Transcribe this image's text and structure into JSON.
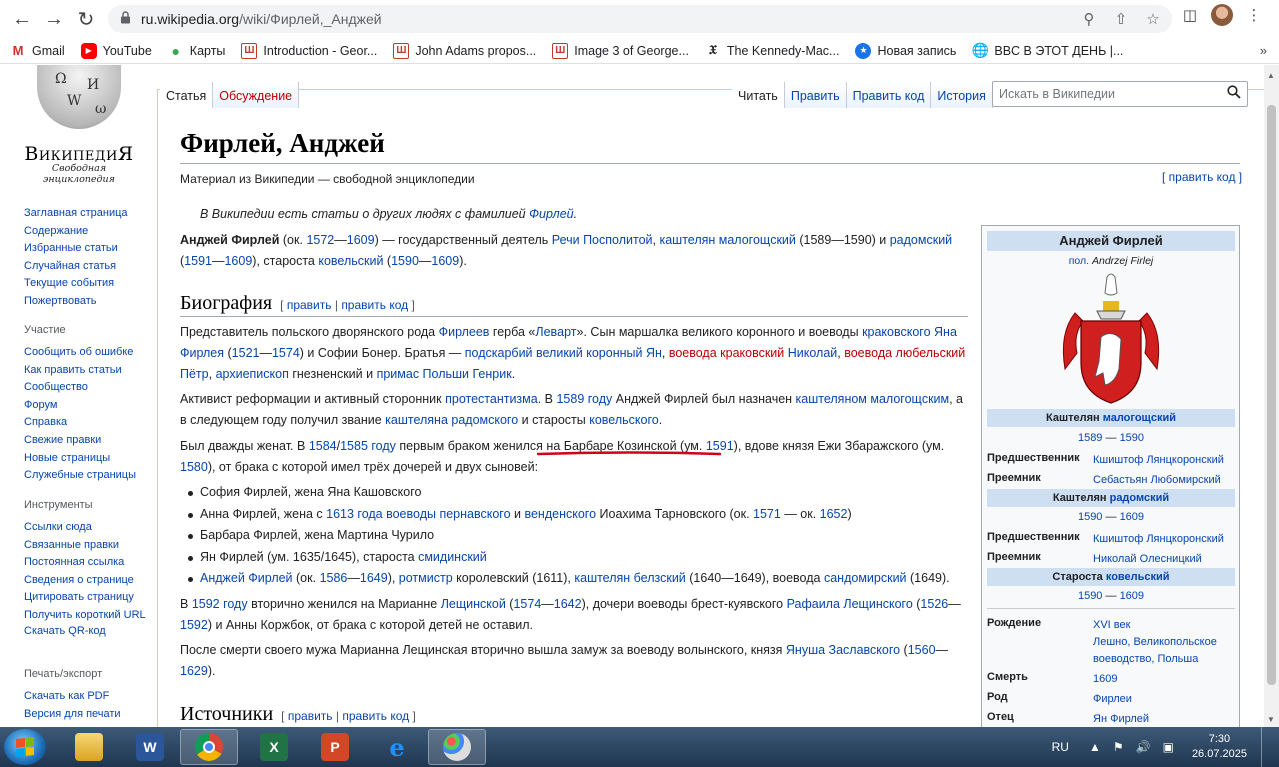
{
  "browser": {
    "url_host": "ru.wikipedia.org",
    "url_path": "/wiki/Фирлей,_Анджей",
    "bookmarks": [
      {
        "label": "Gmail",
        "icon": "gmail-icon"
      },
      {
        "label": "YouTube",
        "icon": "youtube-icon"
      },
      {
        "label": "Карты",
        "icon": "maps-icon"
      },
      {
        "label": "Introduction - Geor...",
        "icon": "bookmark-site-icon"
      },
      {
        "label": "John Adams propos...",
        "icon": "bookmark-site-icon"
      },
      {
        "label": "Image 3 of George...",
        "icon": "bookmark-site-icon"
      },
      {
        "label": "The Kennedy-Mac...",
        "icon": "nyt-icon"
      },
      {
        "label": "Новая запись",
        "icon": "bookmark-site-icon"
      },
      {
        "label": "BBC В ЭТОТ ДЕНЬ |...",
        "icon": "globe-icon"
      }
    ]
  },
  "wiki": {
    "logo_word": "ВикипедиЯ",
    "logo_tagline": "Свободная энциклопедия",
    "nav_main": [
      "Заглавная страница",
      "Содержание",
      "Избранные статьи",
      "Случайная статья",
      "Текущие события",
      "Пожертвовать"
    ],
    "participation_title": "Участие",
    "nav_participation": [
      "Сообщить об ошибке",
      "Как править статьи",
      "Сообщество",
      "Форум",
      "Справка",
      "Свежие правки",
      "Новые страницы",
      "Служебные страницы"
    ],
    "tools_title": "Инструменты",
    "nav_tools": [
      "Ссылки сюда",
      "Связанные правки",
      "Постоянная ссылка",
      "Сведения о странице",
      "Цитировать страницу",
      "Получить короткий URL",
      "Скачать QR-код"
    ],
    "print_title": "Печать/экспорт",
    "nav_print": [
      "Скачать как PDF",
      "Версия для печати"
    ],
    "tab_article": "Статья",
    "tab_talk": "Обсуждение",
    "tab_read": "Читать",
    "tab_edit": "Править",
    "tab_editsource": "Править код",
    "tab_history": "История",
    "search_placeholder": "Искать в Википедии",
    "title": "Фирлей, Анджей",
    "tagline": "Материал из Википедии — свободной энциклопедии",
    "edit_lead": "[ править код ]",
    "hatnote_text": "В Википедии есть статьи о других людях с фамилией ",
    "hatnote_link": "Фирлей",
    "lead": {
      "b1": "Анджей Фирлей",
      "t1": " (ок. ",
      "l1": "1572",
      "t2": "—",
      "l2": "1609",
      "t3": ") — государственный деятель ",
      "l3": "Речи Посполитой",
      "t4": ", ",
      "l4": "каштелян малогощский",
      "t5": " (1589—1590) и ",
      "l5": "радомский",
      "t6": " (",
      "l6": "1591",
      "t7": "—",
      "l7": "1609",
      "t8": "), староста ",
      "l8": "ковельский",
      "t9": " (",
      "l9": "1590",
      "t10": "—",
      "l10": "1609",
      "t11": ")."
    },
    "bio_heading": "Биография",
    "sec_edit": "править",
    "sec_editsource": "править код",
    "sec_open": "[",
    "sec_pipe": "|",
    "sec_close": "]",
    "p1": {
      "t1": "Представитель польского дворянского рода ",
      "l1": "Фирлеев",
      "t2": " герба «",
      "l2": "Левaрт",
      "t3": "». Сын маршалка великого коронного и воеводы ",
      "l3": "краковского Яна Фирлея",
      "t4": " (",
      "l4": "1521",
      "t5": "—",
      "l5": "1574",
      "t6": ") и Софии Бонер. Братья — ",
      "l6": "подскарбий великий коронный Ян",
      "t7": ", ",
      "r1": "воевода краковский",
      "t8": " ",
      "l7": "Николай",
      "t9": ", ",
      "r2": "воевода любельский",
      "t10": " ",
      "l8": "Пётр",
      "t11": ", ",
      "l9": "архиепископ",
      "t12": " гнезненский и ",
      "l10": "примас Польши Генрик",
      "t13": "."
    },
    "p2": {
      "t1": "Активист реформации и активный сторонник ",
      "l1": "протестантизма",
      "t2": ". В ",
      "l2": "1589 году",
      "t3": " Анджей Фирлей был назначен ",
      "l3": "каштеляном малогощским",
      "t4": ", а в следующем году получил звание ",
      "l4": "каштеляна радомского",
      "t5": " и старосты ",
      "l5": "ковельского",
      "t6": "."
    },
    "p3": {
      "t1": "Был дважды женат. В ",
      "l1": "1584",
      "t2": "/",
      "l2": "1585 году",
      "t3": " первым браком женился на Барбаре Козинской (ум. ",
      "l3": "1591",
      "t4": "), вдове князя Ежи Збаражского (ум. ",
      "l4": "1580",
      "t5": "), от брака с которой имел трёх дочерей и двух сыновей:"
    },
    "children": {
      "c1": "София Фирлей, жена Яна Кашовского",
      "c2a": "Анна Фирлей, жена с ",
      "c2b": "1613 года",
      "c2c": " ",
      "c2d": "воеводы пернавского",
      "c2e": " и ",
      "c2f": "венденского",
      "c2g": " Иоахима Тарновского (ок. ",
      "c2h": "1571",
      "c2i": " — ок. ",
      "c2j": "1652",
      "c2k": ")",
      "c3": "Барбара Фирлей, жена Мартина Чурило",
      "c4a": "Ян Фирлей (ум. 1635/1645), староста ",
      "c4b": "смидинский",
      "c5a": "Анджей Фирлей",
      "c5b": " (ок. ",
      "c5c": "1586",
      "c5d": "—",
      "c5e": "1649",
      "c5f": "), ",
      "c5g": "ротмистр",
      "c5h": " королевский (1611), ",
      "c5i": "каштелян белзский",
      "c5j": " (1640—1649), воевода ",
      "c5k": "сандомирский",
      "c5l": " (1649)."
    },
    "p4": {
      "t1": "В ",
      "l1": "1592 году",
      "t2": " вторично женился на Марианне ",
      "l2": "Лещинской",
      "t3": " (",
      "l3": "1574",
      "t4": "—",
      "l4": "1642",
      "t5": "), дочери воеводы брест-куявского ",
      "l5": "Рафаила Лещинского",
      "t6": " (",
      "l6": "1526",
      "t7": "—",
      "l7": "1592",
      "t8": ") и Анны Коржбок, от брака с которой детей не оставил."
    },
    "p5": {
      "t1": "После смерти своего мужа Марианна Лещинская вторично вышла замуж за воеводу волынского, князя ",
      "l1": "Януша Заславского",
      "t2": " (",
      "l2": "1560",
      "t3": "—",
      "l3": "1629",
      "t4": ")."
    },
    "sources_heading": "Источники",
    "infobox": {
      "name": "Анджей Фирлей",
      "orig_prefix": "пол.",
      "orig_name": "Andrzej Firlej",
      "h1a": "Каштелян ",
      "h1b": "малогощский",
      "r1a": "1589",
      "r1b": " — ",
      "r1c": "1590",
      "pred_k": "Предшественник",
      "pred1": "Кшиштоф Лянцкоронский",
      "succ_k": "Преемник",
      "succ1": "Себастьян Любомирский",
      "h2a": "Каштелян ",
      "h2b": "радомский",
      "r2a": "1590",
      "r2b": " — ",
      "r2c": "1609",
      "pred2": "Кшиштоф Лянцкоронский",
      "succ2": "Николай Олесницкий",
      "h3a": "Староста ",
      "h3b": "ковельский",
      "r3a": "1590",
      "r3b": " — ",
      "r3c": "1609",
      "birth_k": "Рождение",
      "birth_v1": "XVI век",
      "birth_v2": "Лешно, Великопольское воеводство, Польша",
      "death_k": "Смерть",
      "death_v": "1609",
      "clan_k": "Род",
      "clan_v": "Фирлеи",
      "father_k": "Отец",
      "father_v": "Ян Фирлей"
    }
  },
  "taskbar": {
    "lang": "RU",
    "time": "7:30",
    "date": "26.07.2025"
  },
  "colors": {
    "link": "#0645ad",
    "redlink": "#ba0000",
    "infobox_header": "#cedff2",
    "annotation": "#d0021b"
  }
}
